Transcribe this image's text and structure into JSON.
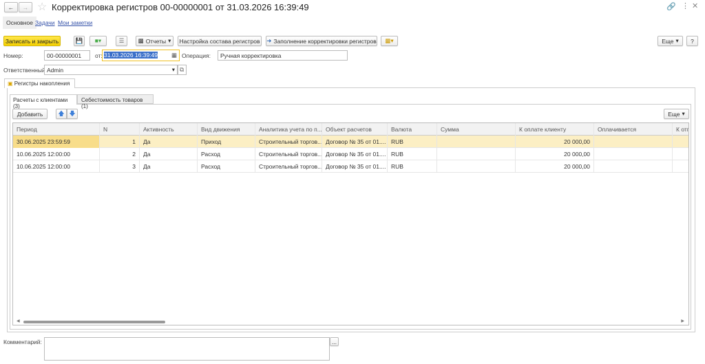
{
  "title": "Корректировка регистров 00-00000001 от 31.03.2026 16:39:49",
  "nav_tabs": [
    "Основное",
    "Задачи",
    "Мои заметки"
  ],
  "toolbar": {
    "save_close": "Записать и закрыть",
    "reports": "Отчеты",
    "settings": "Настройка состава регистров",
    "fill": "Заполнение корректировки регистров",
    "more": "Еще",
    "help": "?"
  },
  "form": {
    "number_label": "Номер:",
    "number": "00-00000001",
    "date_label": "от:",
    "date": "31.03.2026 16:39:49",
    "operation_label": "Операция:",
    "operation": "Ручная корректировка",
    "responsible_label": "Ответственный:",
    "responsible": "Admin",
    "comment_label": "Комментарий:",
    "comment_btn": "..."
  },
  "group_tab": "Регистры накопления",
  "sub_tabs": [
    "Расчеты с клиентами (3)",
    "Себестоимость товаров (1)"
  ],
  "table_toolbar": {
    "add": "Добавить",
    "more": "Еще"
  },
  "columns": [
    "Период",
    "N",
    "Активность",
    "Вид движения",
    "Аналитика учета по п...",
    "Объект расчетов",
    "Валюта",
    "Сумма",
    "К оплате клиенту",
    "Оплачивается",
    "К отгр"
  ],
  "rows": [
    [
      "30.06.2025 23:59:59",
      "1",
      "Да",
      "Приход",
      "Строительный торгов...",
      "Договор № 35 от 01....",
      "RUB",
      "",
      "20 000,00",
      "",
      ""
    ],
    [
      "10.06.2025 12:00:00",
      "2",
      "Да",
      "Расход",
      "Строительный торгов...",
      "Договор № 35 от 01....",
      "RUB",
      "",
      "20 000,00",
      "",
      ""
    ],
    [
      "10.06.2025 12:00:00",
      "3",
      "Да",
      "Расход",
      "Строительный торгов...",
      "Договор № 35 от 01....",
      "RUB",
      "",
      "20 000,00",
      "",
      ""
    ]
  ]
}
